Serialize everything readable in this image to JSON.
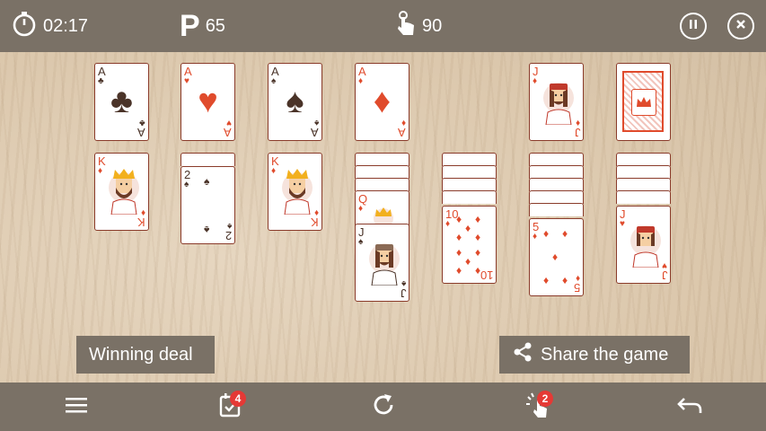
{
  "top_bar": {
    "timer_icon": "stopwatch-icon",
    "timer": "02:17",
    "points_icon": "points-p-icon",
    "points": "65",
    "moves_icon": "tap-hand-icon",
    "moves": "90",
    "pause_icon": "pause-icon",
    "close_icon": "close-icon"
  },
  "board": {
    "foundations": [
      {
        "rank": "A",
        "suit": "♣",
        "color": "black"
      },
      {
        "rank": "A",
        "suit": "♥",
        "color": "red"
      },
      {
        "rank": "A",
        "suit": "♠",
        "color": "black"
      },
      {
        "rank": "A",
        "suit": "♦",
        "color": "red"
      }
    ],
    "waste": {
      "rank": "J",
      "suit": "♦",
      "color": "red"
    },
    "stock": "card-back",
    "tableau": [
      {
        "face_down": 0,
        "cards": [
          {
            "rank": "K",
            "suit": "♦",
            "color": "red"
          }
        ]
      },
      {
        "face_down": 0,
        "cards": [
          {
            "rank": "2",
            "suit": "♠",
            "color": "black"
          }
        ]
      },
      {
        "face_down": 0,
        "cards": [
          {
            "rank": "K",
            "suit": "♦",
            "color": "red"
          }
        ]
      },
      {
        "face_down": 3,
        "cards": [
          {
            "rank": "Q",
            "suit": "♦",
            "color": "red"
          },
          {
            "rank": "J",
            "suit": "♠",
            "color": "black"
          }
        ]
      },
      {
        "face_down": 4,
        "cards": [
          {
            "rank": "10",
            "suit": "♦",
            "color": "red"
          }
        ]
      },
      {
        "face_down": 5,
        "cards": [
          {
            "rank": "5",
            "suit": "♦",
            "color": "red"
          }
        ]
      },
      {
        "face_down": 4,
        "cards": [
          {
            "rank": "J",
            "suit": "♥",
            "color": "red"
          }
        ]
      }
    ]
  },
  "actions": {
    "winning_deal": "Winning deal",
    "share_game": "Share the game",
    "share_icon": "share-icon"
  },
  "bottom_bar": {
    "menu_icon": "menu-icon",
    "daily_icon": "calendar-check-icon",
    "daily_badge": "4",
    "restart_icon": "restart-icon",
    "hint_icon": "hint-lightbulb-icon",
    "hint_badge": "2",
    "undo_icon": "undo-icon"
  },
  "colors": {
    "bar": "#7a7166",
    "card_border": "#8a3b2a",
    "red_suit": "#e04b2c",
    "black_suit": "#4a3328",
    "badge": "#e53935"
  }
}
